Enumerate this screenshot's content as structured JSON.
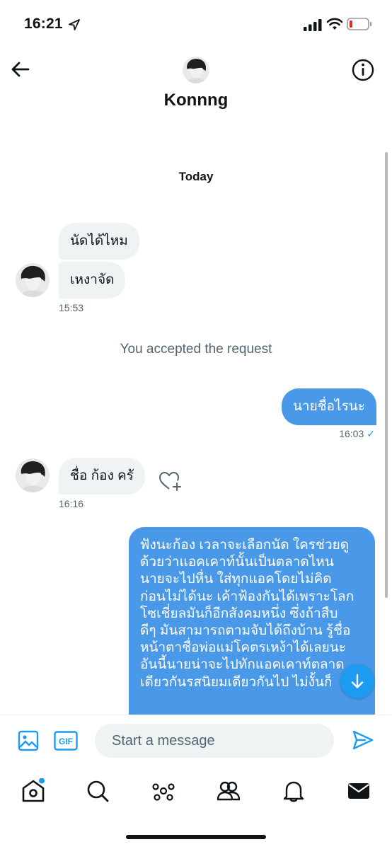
{
  "status_bar": {
    "time": "16:21",
    "icons": [
      "location-arrow-icon",
      "cellular-signal-icon",
      "wifi-icon",
      "battery-low-icon"
    ]
  },
  "header": {
    "name": "Konnng",
    "back_icon": "arrow-left-icon",
    "info_icon": "info-icon"
  },
  "conversation": {
    "day_label": "Today",
    "messages": [
      {
        "direction": "in",
        "text": "นัดได้ไหม"
      },
      {
        "direction": "in",
        "text": "เหงาจัด",
        "time": "15:53"
      },
      {
        "type": "system",
        "text": "You accepted the request"
      },
      {
        "direction": "out",
        "text": "นายชื่อไรนะ",
        "time": "16:03",
        "status_icon": "check-icon"
      },
      {
        "direction": "in",
        "text": "ชื่อ ก้อง ครั",
        "time": "16:16",
        "reaction_icon": "heart-plus-icon"
      },
      {
        "direction": "out",
        "lines": [
          "ฟังนะก้อง เวลาจะเลือกนัด ใครช่วยดู",
          "ด้วยว่าแอคเคาท์นั้นเป็นตลาดไหน",
          "นายจะไปหื่น ใส่ทุกแอคโดยไม่คิด",
          "ก่อนไม่ได้นะ เค้าฟ้องกันได้เพราะโลก",
          "โซเชี่ยลมันก็อีกสังคมหนึ่ง ซึ่งถ้าสืบ",
          "ดีๆ มันสามารถตามจับได้ถึงบ้าน รู้ชื่อ",
          "หน้าตาชื่อพ่อแม่โคตรเหง้าได้เลยนะ",
          "อันนี้นายน่าจะไปทักแอคเคาท์ตลาด",
          "เดียวกันรสนิยมเดียวกันไป ไม่งั้นก็"
        ]
      }
    ],
    "check_mark": "✓"
  },
  "composer": {
    "placeholder": "Start a message",
    "gif_label": "GIF",
    "image_icon": "image-icon",
    "send_icon": "send-icon"
  },
  "tabbar": {
    "tabs": [
      "home-icon",
      "search-icon",
      "spaces-icon",
      "communities-icon",
      "notifications-icon",
      "messages-icon"
    ],
    "accent": "#1d9bf0"
  },
  "colors": {
    "accent": "#1d9bf0",
    "outgoing_bubble": "#4a99e9",
    "incoming_bubble": "#eff3f4",
    "secondary_text": "#536471"
  }
}
